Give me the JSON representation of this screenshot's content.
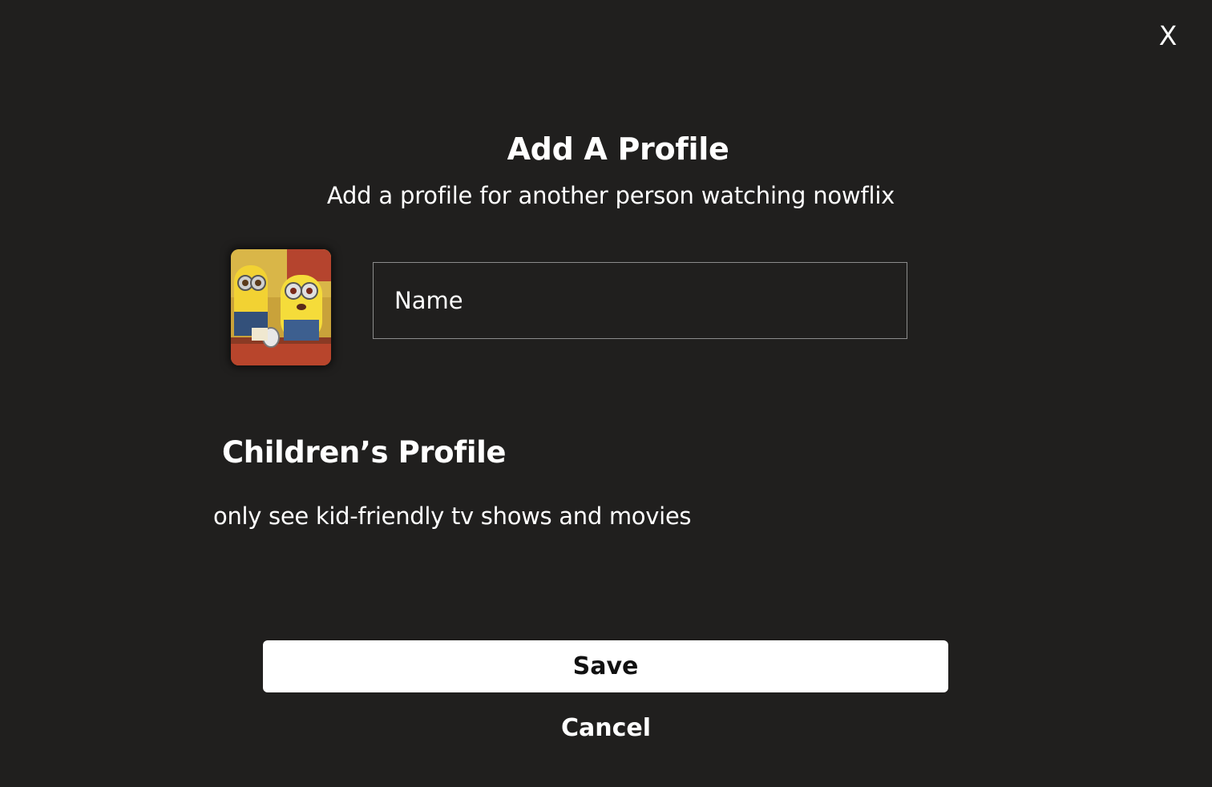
{
  "dialog": {
    "close_label": "X",
    "title": "Add A Profile",
    "subtitle": "Add a profile for another person watching nowflix"
  },
  "profile": {
    "avatar_icon": "minions-avatar",
    "name_placeholder": "Name",
    "name_value": ""
  },
  "children_section": {
    "heading": "Children’s Profile",
    "description": "only see kid-friendly tv shows and movies"
  },
  "actions": {
    "save_label": "Save",
    "cancel_label": "Cancel"
  },
  "colors": {
    "background": "#201f1e",
    "text": "#ffffff",
    "save_button_bg": "#ffffff",
    "input_border": "#8c8c8c"
  }
}
